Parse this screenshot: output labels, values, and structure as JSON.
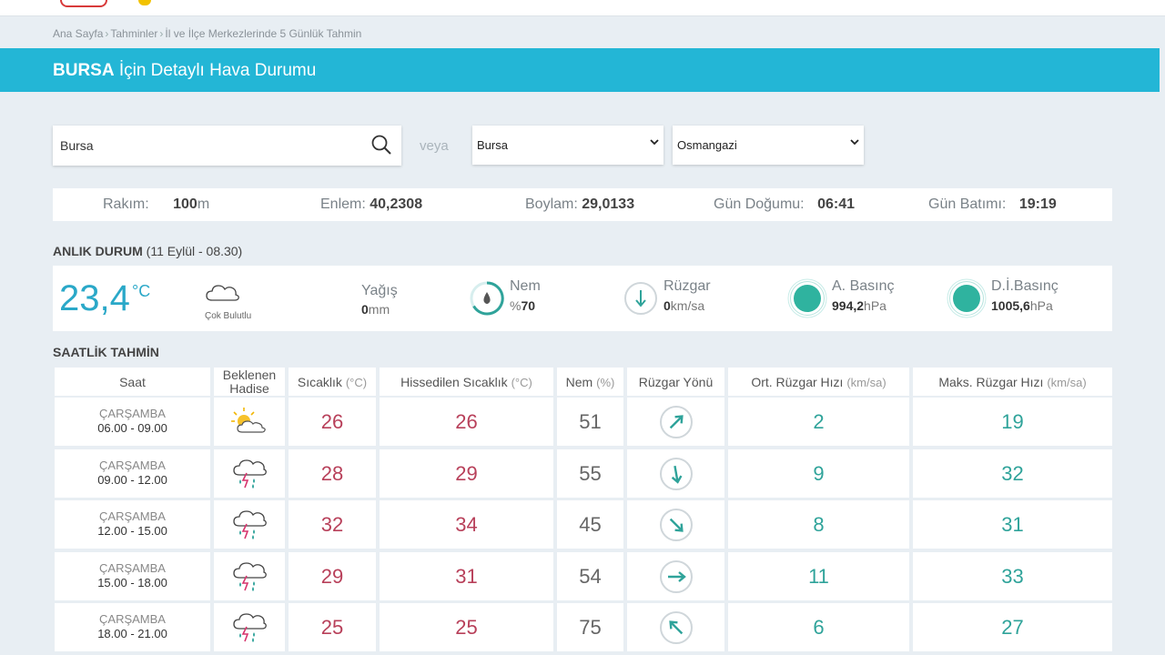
{
  "breadcrumb": [
    "Ana Sayfa",
    "Tahminler",
    "İl ve İlçe Merkezlerinde 5 Günlük Tahmin"
  ],
  "banner": {
    "city": "BURSA",
    "rest": " İçin Detaylı Hava Durumu"
  },
  "search": {
    "value": "Bursa"
  },
  "veya": "veya",
  "select_city": "Bursa",
  "select_district": "Osmangazi",
  "info": {
    "rakim_label": "Rakım:",
    "rakim_value": "100",
    "rakim_unit": "m",
    "enlem_label": "Enlem:",
    "enlem_value": "40,2308",
    "boylam_label": "Boylam:",
    "boylam_value": "29,0133",
    "dogum_label": "Gün Doğumu:",
    "dogum_value": "06:41",
    "batim_label": "Gün Batımı:",
    "batim_value": "19:19"
  },
  "current": {
    "title": "ANLIK DURUM",
    "stamp": "(11 Eylül - 08.30)",
    "temp": "23,4",
    "temp_unit": "°C",
    "condition": "Çok Bulutlu",
    "yagis_label": "Yağış",
    "yagis_value": "0",
    "yagis_unit": "mm",
    "nem_label": "Nem",
    "nem_prefix": "%",
    "nem_value": "70",
    "ruzgar_label": "Rüzgar",
    "ruzgar_value": "0",
    "ruzgar_unit": "km/sa",
    "abasinc_label": "A. Basınç",
    "abasinc_value": "994,2",
    "abasinc_unit": "hPa",
    "dibasinc_label": "D.İ.Basınç",
    "dibasinc_value": "1005,6",
    "dibasinc_unit": "hPa"
  },
  "hourly": {
    "title": "SAATLİK TAHMİN",
    "headers": {
      "saat": "Saat",
      "hadise_1": "Beklenen",
      "hadise_2": "Hadise",
      "sicaklik": "Sıcaklık",
      "sicaklik_u": "(°C)",
      "hissedilen": "Hissedilen Sıcaklık",
      "hissedilen_u": "(°C)",
      "nem": "Nem",
      "nem_u": "(%)",
      "yon": "Rüzgar Yönü",
      "ort": "Ort. Rüzgar Hızı",
      "ort_u": "(km/sa)",
      "maks": "Maks. Rüzgar Hızı",
      "maks_u": "(km/sa)"
    },
    "rows": [
      {
        "day": "ÇARŞAMBA",
        "time": "06.00 - 09.00",
        "icon": "partly-cloudy-sun-icon",
        "temp": "26",
        "feels": "26",
        "hum": "51",
        "dir_deg": 45,
        "avg": "2",
        "max": "19"
      },
      {
        "day": "ÇARŞAMBA",
        "time": "09.00 - 12.00",
        "icon": "thunderstorm-rain-icon",
        "temp": "28",
        "feels": "29",
        "hum": "55",
        "dir_deg": 170,
        "avg": "9",
        "max": "32"
      },
      {
        "day": "ÇARŞAMBA",
        "time": "12.00 - 15.00",
        "icon": "thunderstorm-rain-icon",
        "temp": "32",
        "feels": "34",
        "hum": "45",
        "dir_deg": 135,
        "avg": "8",
        "max": "31"
      },
      {
        "day": "ÇARŞAMBA",
        "time": "15.00 - 18.00",
        "icon": "thunderstorm-rain-icon",
        "temp": "29",
        "feels": "31",
        "hum": "54",
        "dir_deg": 90,
        "avg": "11",
        "max": "33"
      },
      {
        "day": "ÇARŞAMBA",
        "time": "18.00 - 21.00",
        "icon": "thunderstorm-rain-icon",
        "temp": "25",
        "feels": "25",
        "hum": "75",
        "dir_deg": 315,
        "avg": "6",
        "max": "27"
      }
    ]
  },
  "colors": {
    "accent": "#23b6d6",
    "teal": "#2fa39a",
    "red": "#b8405a"
  }
}
